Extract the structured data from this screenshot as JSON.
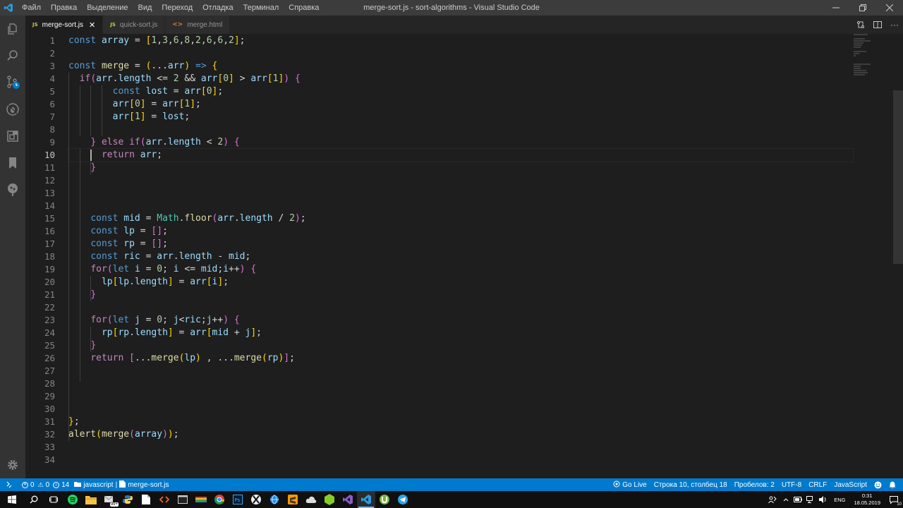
{
  "menu": [
    "Файл",
    "Правка",
    "Выделение",
    "Вид",
    "Переход",
    "Отладка",
    "Терминал",
    "Справка"
  ],
  "window_title": "merge-sort.js - sort-algorithms - Visual Studio Code",
  "tabs": [
    {
      "icon": "JS",
      "label": "merge-sort.js"
    },
    {
      "icon": "JS",
      "label": "quick-sort.js"
    },
    {
      "icon": "<>",
      "label": "merge.html"
    }
  ],
  "line_numbers": [
    "1",
    "2",
    "3",
    "4",
    "5",
    "6",
    "7",
    "8",
    "9",
    "10",
    "11",
    "12",
    "13",
    "14",
    "15",
    "16",
    "17",
    "18",
    "19",
    "20",
    "21",
    "22",
    "23",
    "24",
    "25",
    "26",
    "27",
    "28",
    "29",
    "30",
    "31",
    "32",
    "33",
    "34"
  ],
  "code": [
    "const array = [1,3,6,8,2,6,6,2];",
    "",
    "const merge = (...arr) => {",
    "  if(arr.length <= 2 && arr[0] > arr[1]) {",
    "        const lost = arr[0];",
    "        arr[0] = arr[1];",
    "        arr[1] = lost;",
    "",
    "    } else if(arr.length < 2) {",
    "      return arr;",
    "    }",
    "",
    "",
    "",
    "    const mid = Math.floor(arr.length / 2);",
    "    const lp = [];",
    "    const rp = [];",
    "    const ric = arr.length - mid;",
    "    for(let i = 0; i <= mid;i++) {",
    "      lp[lp.length] = arr[i];",
    "    }",
    "",
    "    for(let j = 0; j<ric;j++) {",
    "      rp[rp.length] = arr[mid + j];",
    "    }",
    "    return [...merge(lp) , ...merge(rp)];",
    "",
    "",
    "",
    "",
    "};",
    "alert(merge(array));",
    "",
    ""
  ],
  "status": {
    "errors": "0",
    "warnings": "0",
    "info": "14",
    "crumb_lang": "javascript",
    "crumb_sep": "|",
    "crumb_file": "merge-sort.js",
    "go_live": "Go Live",
    "position": "Строка 10, столбец 18",
    "spaces": "Пробелов: 2",
    "encoding": "UTF-8",
    "eol": "CRLF",
    "language": "JavaScript"
  },
  "taskbar": {
    "badge": "99+",
    "lang": "ENG",
    "time": "0:31",
    "date": "18.05.2019",
    "notif_count": "10"
  },
  "colors": {
    "accent": "#007acc",
    "editor_bg": "#1e1e1e",
    "keyword": "#569cd6",
    "control": "#c586c0",
    "variable": "#9cdcfe",
    "number": "#b5cea8"
  }
}
